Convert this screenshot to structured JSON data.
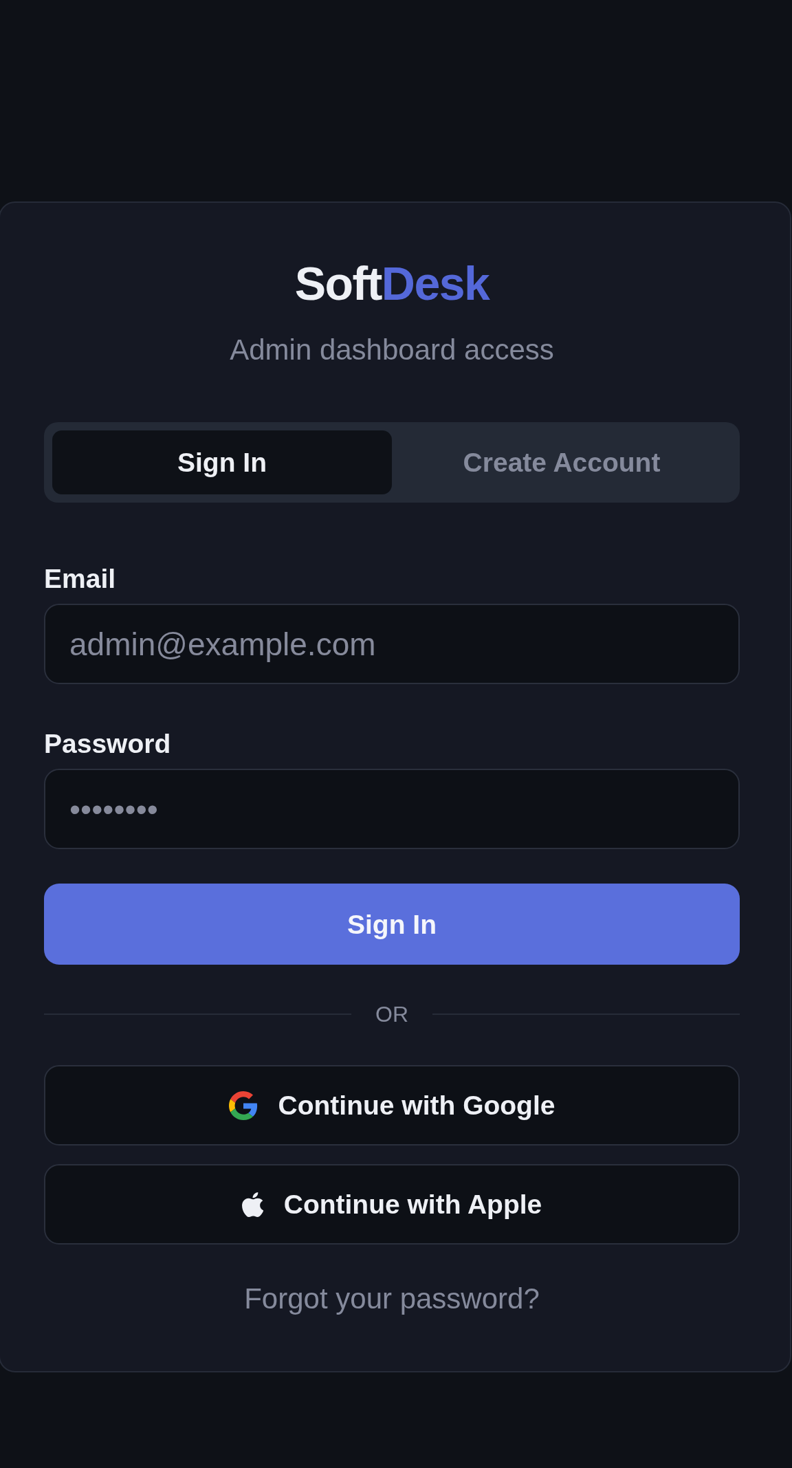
{
  "brand": {
    "parts": [
      {
        "text": "Soft",
        "kind": "plain"
      },
      {
        "text": "Desk",
        "kind": "accent"
      }
    ]
  },
  "subtitle": "Admin dashboard access",
  "tabs": [
    {
      "label": "Sign In",
      "selected": true
    },
    {
      "label": "Create Account",
      "selected": false
    }
  ],
  "fields": [
    {
      "label": "Email",
      "placeholder": "admin@example.com"
    },
    {
      "label": "Password",
      "placeholder": "••••••••"
    }
  ],
  "submit_button": {
    "label": "Sign In"
  },
  "divider": {
    "label": "OR"
  },
  "social_buttons": [
    {
      "label": "Continue with Google",
      "kind": "google"
    },
    {
      "label": "Continue with Apple",
      "kind": "apple"
    }
  ],
  "forgot_link": {
    "label": "Forgot your password?"
  }
}
